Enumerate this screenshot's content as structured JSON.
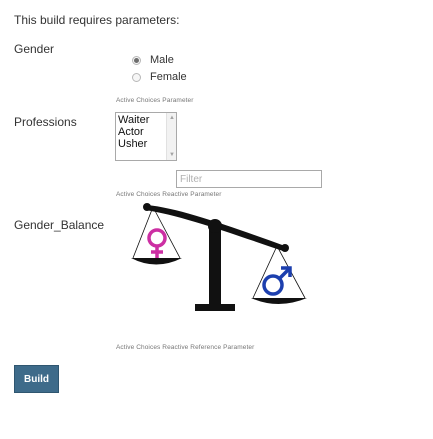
{
  "intro_text": "This build requires parameters:",
  "parameters": {
    "gender": {
      "label": "Gender",
      "options": [
        {
          "label": "Male",
          "checked": true
        },
        {
          "label": "Female",
          "checked": false
        }
      ],
      "caption": "Active Choices Parameter"
    },
    "professions": {
      "label": "Professions",
      "items": [
        "Waiter",
        "Actor",
        "Usher"
      ],
      "filter_placeholder": "Filter",
      "caption": "Active Choices Reactive Parameter"
    },
    "gender_balance": {
      "label": "Gender_Balance",
      "caption": "Active Choices Reactive Reference Parameter",
      "image": {
        "female_symbol_color": "#cc2fa3",
        "male_symbol_color": "#1c3fae",
        "scale_color": "#111111"
      }
    }
  },
  "build_button_label": "Build",
  "colors": {
    "button_bg": "#3e6b8a",
    "text": "#333333",
    "caption": "#777777"
  }
}
